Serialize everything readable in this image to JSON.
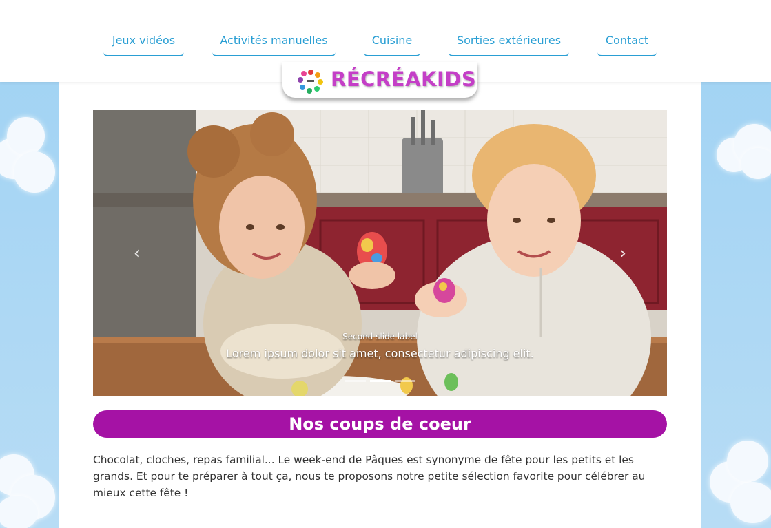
{
  "nav": {
    "items": [
      {
        "label": "Jeux vidéos"
      },
      {
        "label": "Activités manuelles"
      },
      {
        "label": "Cuisine"
      },
      {
        "label": "Sorties extérieures"
      },
      {
        "label": "Contact"
      }
    ]
  },
  "brand": {
    "name": "RÉCRÉAKIDS",
    "color": "#c43fc7"
  },
  "carousel": {
    "prev_label": "‹",
    "next_label": "›",
    "slide_label": "Second slide label",
    "slide_text": "Lorem ipsum dolor sit amet, consectetur adipiscing elit.",
    "active_index": 1,
    "slide_count": 3
  },
  "section": {
    "title": "Nos coups de coeur",
    "intro": "Chocolat, cloches, repas familial... Le week-end de Pâques est synonyme de fête pour les petits et les grands. Et pour te préparer à tout ça, nous te proposons notre petite sélection favorite pour célébrer au mieux cette fête !"
  },
  "colors": {
    "nav_link": "#2a9fd4",
    "accent_purple": "#a512a5",
    "sky": "#a9d6f5"
  }
}
